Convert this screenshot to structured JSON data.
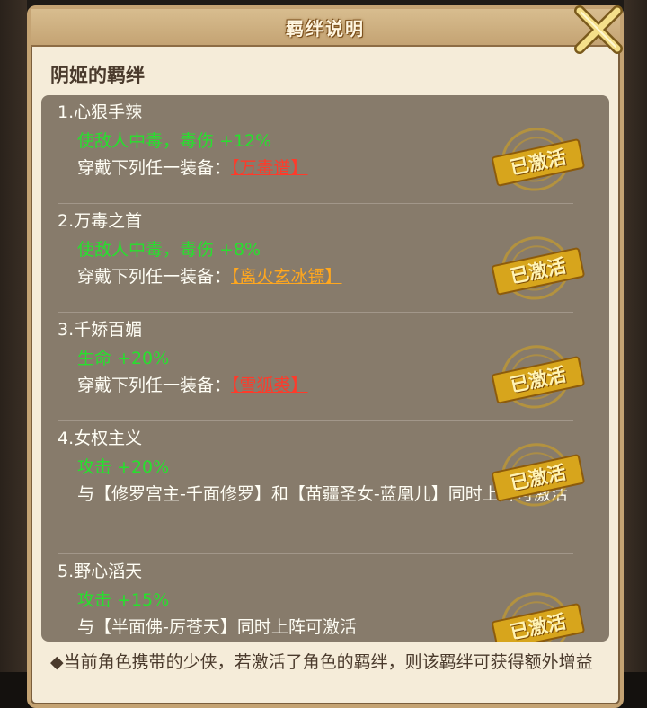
{
  "dialog": {
    "title": "羁绊说明",
    "heading": "阴姬的羁绊",
    "stamp_text": "已激活",
    "footer": "◆当前角色携带的少侠，若激活了角色的羁绊，则该羁绊可获得额外增益"
  },
  "bonds": [
    {
      "name": "1.心狠手辣",
      "effect": "使敌人中毒，毒伤 +12%",
      "req_prefix": "穿戴下列任一装备：",
      "req_item": "【万毒谱】"
    },
    {
      "name": "2.万毒之首",
      "effect": "使敌人中毒，毒伤 +8%",
      "req_prefix": "穿戴下列任一装备：",
      "req_item": "【离火玄冰镖】"
    },
    {
      "name": "3.千娇百媚",
      "effect": "生命 +20%",
      "req_prefix": "穿戴下列任一装备：",
      "req_item": "【雪狐裘】"
    },
    {
      "name": "4.女权主义",
      "effect": "攻击 +20%",
      "req_text": "与【修罗宫主-千面修罗】和【苗疆圣女-蓝凰儿】同时上阵可激活"
    },
    {
      "name": "5.野心滔天",
      "effect": "攻击 +15%",
      "req_text": "与【半面佛-厉苍天】同时上阵可激活"
    }
  ],
  "colors": {
    "effect_green": "#27e02e",
    "item_red": "#ff3a2a",
    "item_orange": "#ffa71e",
    "stamp_gold": "#d7a51c"
  },
  "icons": {
    "close": "close-x-icon"
  }
}
